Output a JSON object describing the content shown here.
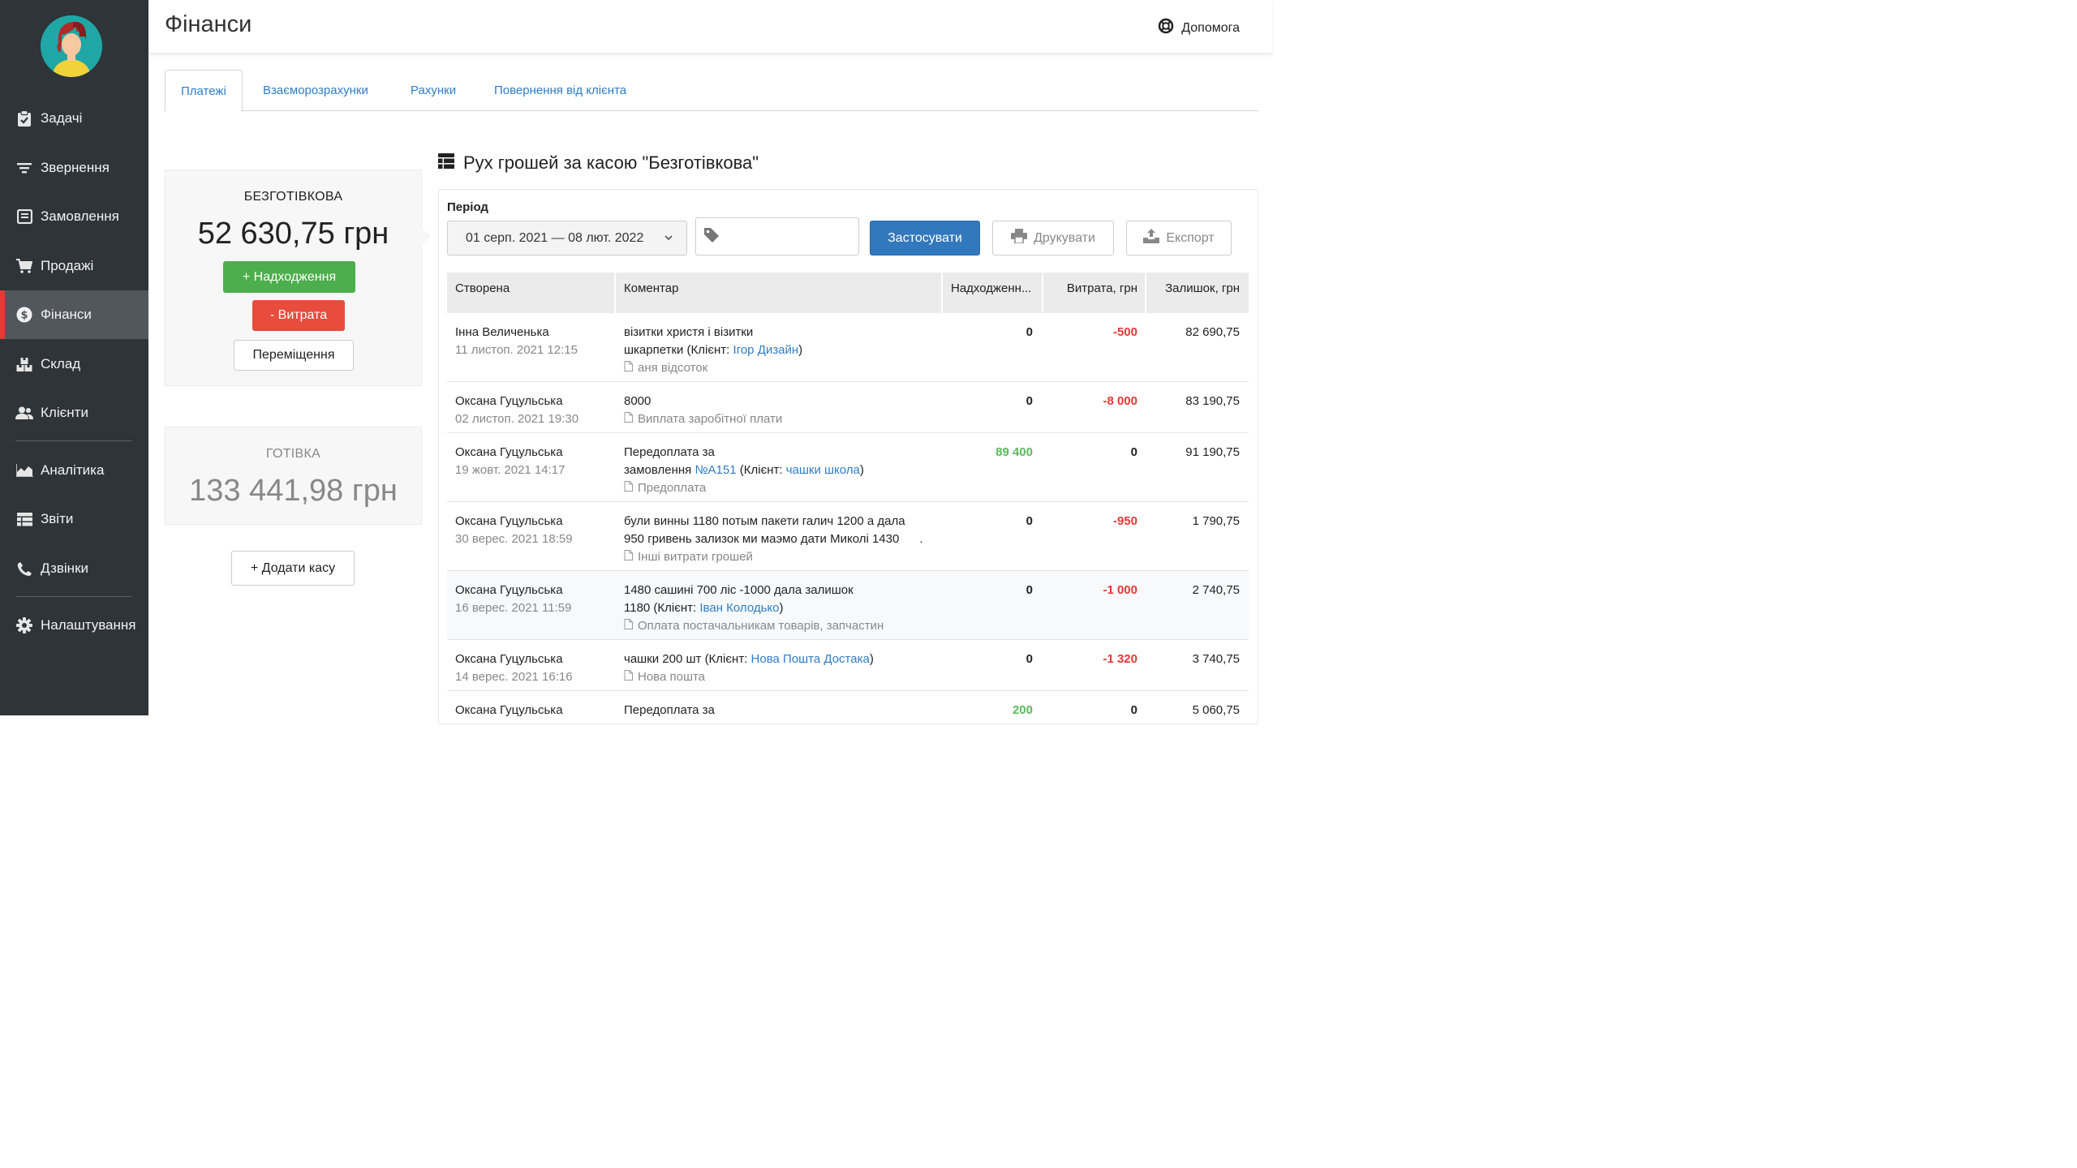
{
  "sidebar": {
    "items": [
      {
        "label": "Задачі",
        "icon": "clipboard-check-icon"
      },
      {
        "label": "Звернення",
        "icon": "filter-icon"
      },
      {
        "label": "Замовлення",
        "icon": "order-icon"
      },
      {
        "label": "Продажі",
        "icon": "cart-icon"
      },
      {
        "label": "Фінанси",
        "icon": "dollar-circle-icon",
        "active": true
      },
      {
        "label": "Склад",
        "icon": "boxes-icon"
      },
      {
        "label": "Клієнти",
        "icon": "users-icon"
      },
      {
        "label": "Аналітика",
        "icon": "area-chart-icon"
      },
      {
        "label": "Звіти",
        "icon": "table-icon"
      },
      {
        "label": "Дзвінки",
        "icon": "phone-icon"
      },
      {
        "label": "Налаштування",
        "icon": "gear-icon"
      }
    ]
  },
  "header": {
    "title": "Фінанси",
    "help": "Допомога"
  },
  "tabs": [
    {
      "label": "Платежі",
      "active": true
    },
    {
      "label": "Взаєморозрахунки"
    },
    {
      "label": "Рахунки"
    },
    {
      "label": "Повернення від клієнта"
    }
  ],
  "cashboxes": [
    {
      "name": "БЕЗГОТІВКОВА",
      "amount": "52 630,75 грн",
      "active": true
    },
    {
      "name": "ГОТІВКА",
      "amount": "133 441,98 грн"
    }
  ],
  "cash_actions": {
    "income": "+ Надходження",
    "expense": "- Витрата",
    "transfer": "Переміщення",
    "add": "+ Додати касу"
  },
  "main": {
    "title": "Рух грошей за касою \"Безготівкова\"",
    "period_label": "Період",
    "period_value": "01 серп. 2021 — 08 лют. 2022",
    "apply": "Застосувати",
    "print": "Друкувати",
    "export": "Експорт"
  },
  "table": {
    "columns": [
      "Створена",
      "Коментар",
      "Надходженн...",
      "Витрата, грн",
      "Залишок, грн"
    ],
    "rows": [
      {
        "author": "Інна Величенька",
        "date": "11 листоп. 2021 12:15",
        "c1": "візитки христя і візитки",
        "c2": "шкарпетки  (Клієнт: ",
        "link": "Ігор Дизайн",
        "c2end": ")",
        "cat": "аня відсоток",
        "in": "0",
        "out": "-500",
        "bal": "82 690,75"
      },
      {
        "author": "Оксана Гуцульська",
        "date": "02 листоп. 2021 19:30",
        "c1": "8000",
        "cat": "Виплата заробітної плати",
        "in": "0",
        "out": "-8 000",
        "bal": "83 190,75"
      },
      {
        "author": "Оксана Гуцульська",
        "date": "19 жовт. 2021 14:17",
        "c1": "Передоплата за",
        "c2": "замовлення  ",
        "link": "№А151",
        "c2mid": "  (Клієнт: ",
        "link2": "чашки школа",
        "c2end": ")",
        "cat": "Предоплата",
        "in": "89 400",
        "out": "0",
        "bal": "91 190,75"
      },
      {
        "author": "Оксана Гуцульська",
        "date": "30 верес. 2021 18:59",
        "c1": "були винны 1180 потым пакети галич 1200 а дала",
        "c2": "950 гривень зализок ми маэмо дати Миколі 1430",
        "c2end": "      .",
        "cat": "Інші витрати грошей",
        "in": "0",
        "out": "-950",
        "bal": "1 790,75"
      },
      {
        "author": "Оксана Гуцульська",
        "date": "16 верес. 2021 11:59",
        "c1": "1480 сашині 700 ліс -1000 дала залишок",
        "c2": "1180  (Клієнт: ",
        "link": "Іван Колодько",
        "c2end": ")",
        "cat": "Оплата постачальникам товарів, запчастин",
        "in": "0",
        "out": "-1 000",
        "bal": "2 740,75"
      },
      {
        "author": "Оксана Гуцульська",
        "date": "14 верес. 2021 16:16",
        "c1": "чашки 200 шт  (Клієнт: ",
        "link": "Нова Пошта Достака",
        "c1end": ")",
        "cat": "Нова пошта",
        "in": "0",
        "out": "-1 320",
        "bal": "3 740,75"
      },
      {
        "author": "Оксана Гуцульська",
        "c1": "Передоплата за",
        "in": "200",
        "out": "0",
        "bal": "5 060,75"
      }
    ]
  }
}
